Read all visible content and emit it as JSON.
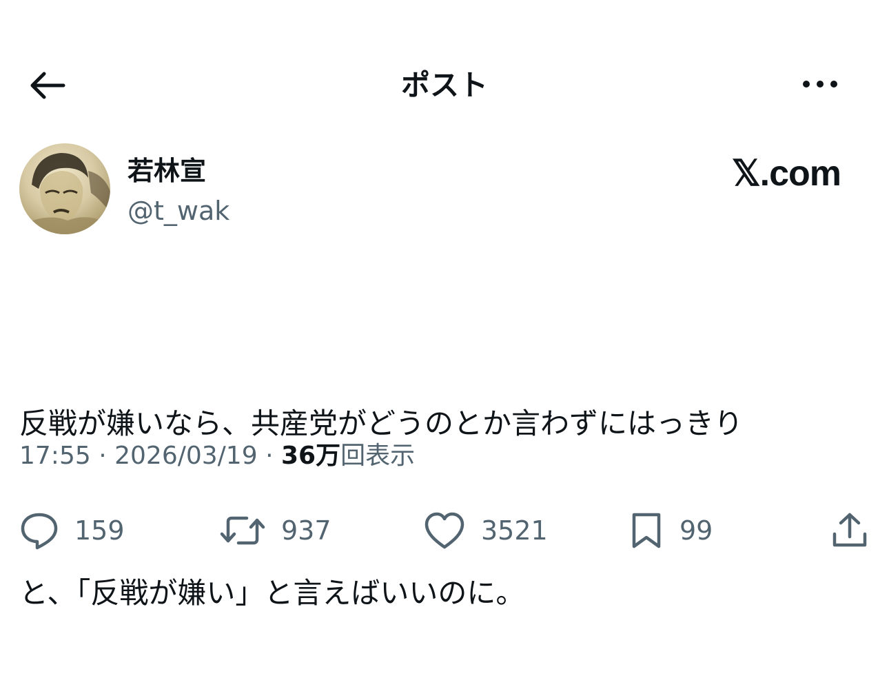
{
  "header": {
    "title": "ポスト"
  },
  "author": {
    "display_name": "若林宣",
    "handle": "@t_wak",
    "brand": "𝕏.com"
  },
  "tweet": {
    "text_line1": "反戦が嫌いなら、共産党がどうのとか言わずにはっきり",
    "text_line2": "と、「反戦が嫌い」と言えばいいのに。"
  },
  "meta": {
    "time": "17:55",
    "date": "2026/03/19",
    "views_count": "36万",
    "views_label": "回表示",
    "separator": "·"
  },
  "actions": {
    "replies": "159",
    "reposts": "937",
    "likes": "3521",
    "bookmarks": "99"
  },
  "icons": [
    "back-arrow-icon",
    "more-icon",
    "reply-icon",
    "repost-icon",
    "like-icon",
    "bookmark-icon",
    "share-icon"
  ],
  "colors": {
    "text": "#0f1419",
    "secondary": "#536471",
    "background": "#ffffff"
  }
}
